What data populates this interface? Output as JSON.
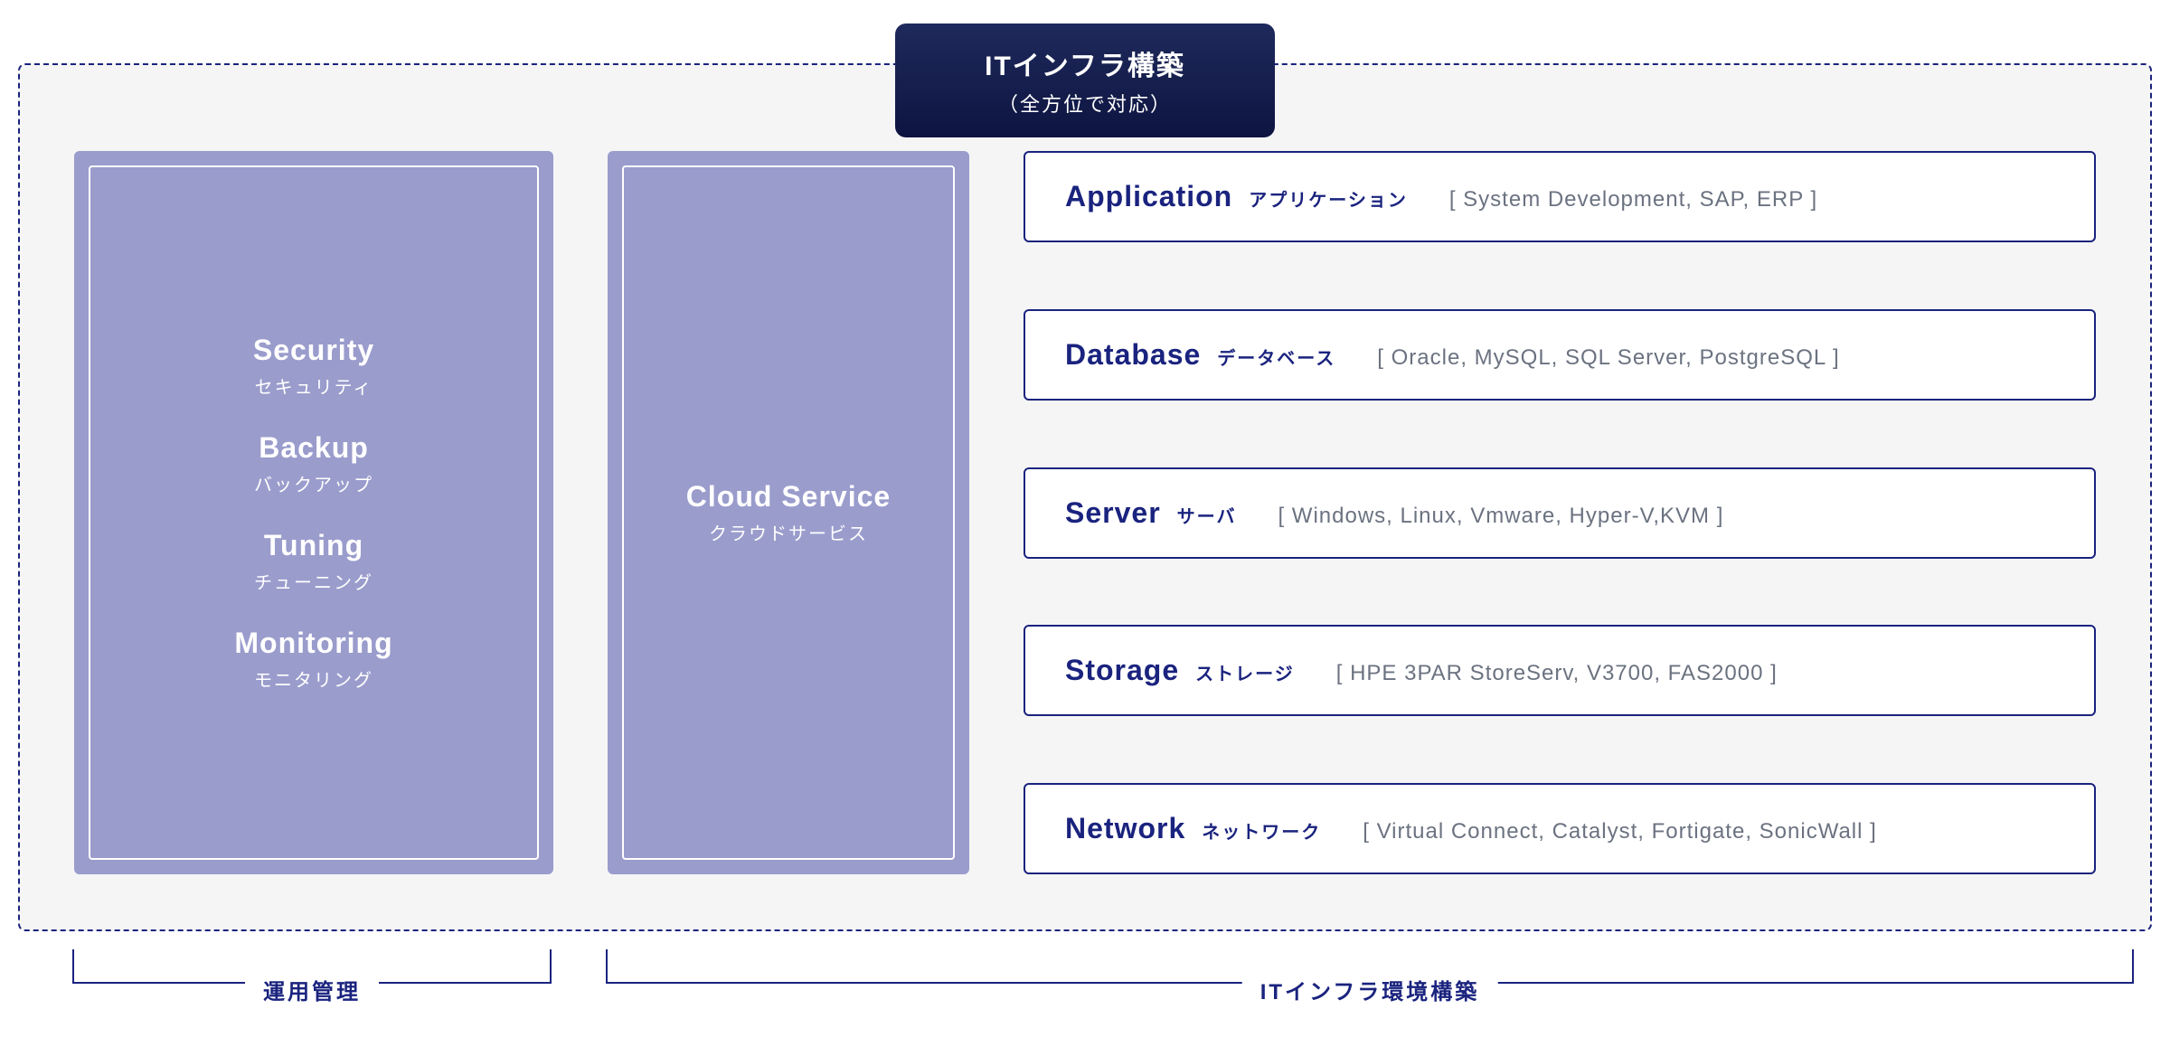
{
  "header": {
    "title": "ITインフラ構築",
    "subtitle": "（全方位で対応）"
  },
  "left_box": {
    "items": [
      {
        "en": "Security",
        "jp": "セキュリティ"
      },
      {
        "en": "Backup",
        "jp": "バックアップ"
      },
      {
        "en": "Tuning",
        "jp": "チューニング"
      },
      {
        "en": "Monitoring",
        "jp": "モニタリング"
      }
    ]
  },
  "center_box": {
    "en": "Cloud Service",
    "jp": "クラウドサービス"
  },
  "right_layers": [
    {
      "en": "Application",
      "jp": "アプリケーション",
      "tech": "[ System Development, SAP, ERP ]"
    },
    {
      "en": "Database",
      "jp": "データベース",
      "tech": "[ Oracle, MySQL, SQL Server, PostgreSQL ]"
    },
    {
      "en": "Server",
      "jp": "サーバ",
      "tech": "[ Windows, Linux, Vmware, Hyper-V,KVM ]"
    },
    {
      "en": "Storage",
      "jp": "ストレージ",
      "tech": "[ HPE 3PAR StoreServ, V3700, FAS2000 ]"
    },
    {
      "en": "Network",
      "jp": "ネットワーク",
      "tech": "[ Virtual Connect, Catalyst, Fortigate, SonicWall ]"
    }
  ],
  "bottom": {
    "left_label": "運用管理",
    "right_label": "ITインフラ環境構築"
  }
}
